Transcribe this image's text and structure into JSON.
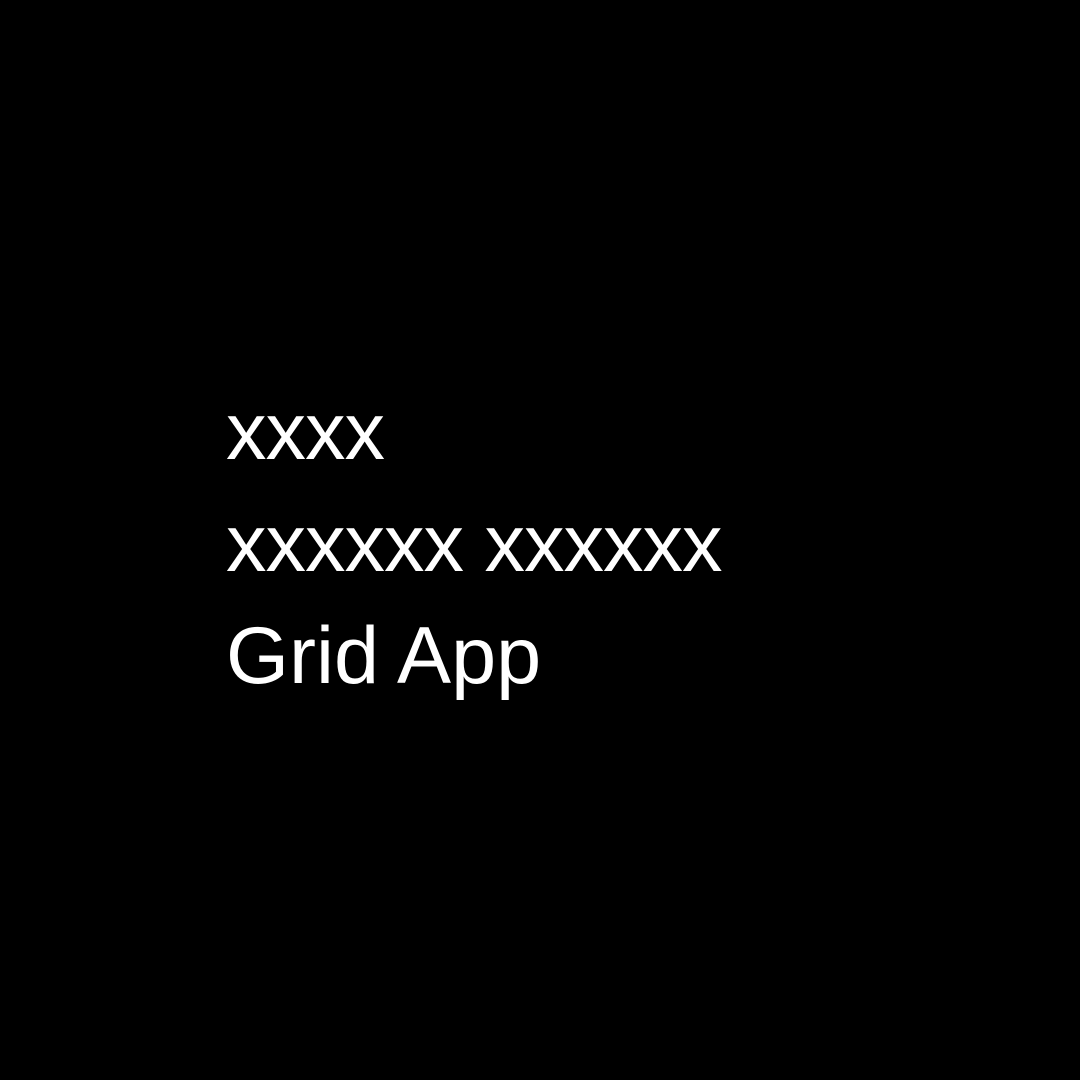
{
  "screen": {
    "background_color": "#000000",
    "text_color": "#ffffff",
    "lines": [
      "xxxx",
      "xxxxxx xxxxxx",
      "Grid App"
    ]
  }
}
